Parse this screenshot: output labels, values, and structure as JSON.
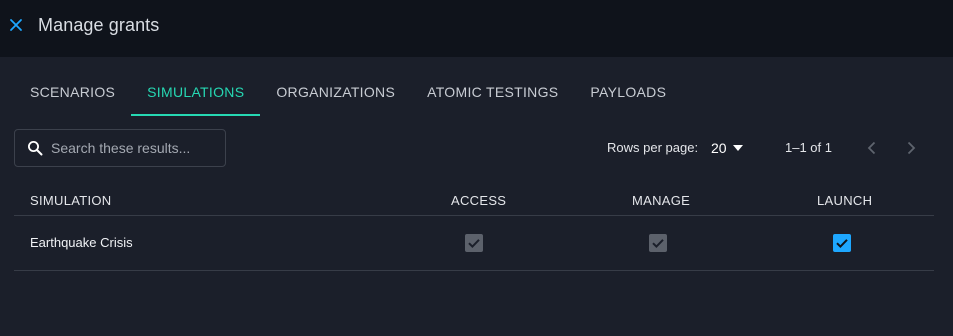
{
  "header": {
    "title": "Manage grants",
    "close_icon": "close-icon"
  },
  "tabs": [
    {
      "label": "SCENARIOS",
      "active": false
    },
    {
      "label": "SIMULATIONS",
      "active": true
    },
    {
      "label": "ORGANIZATIONS",
      "active": false
    },
    {
      "label": "ATOMIC TESTINGS",
      "active": false
    },
    {
      "label": "PAYLOADS",
      "active": false
    }
  ],
  "search": {
    "placeholder": "Search these results...",
    "value": ""
  },
  "pagination": {
    "rows_per_page_label": "Rows per page:",
    "rows_per_page_value": "20",
    "range_text": "1–1 of 1"
  },
  "table": {
    "columns": [
      "SIMULATION",
      "ACCESS",
      "MANAGE",
      "LAUNCH"
    ],
    "rows": [
      {
        "simulation": "Earthquake Crisis",
        "access": true,
        "manage": true,
        "launch": true,
        "access_disabled": true,
        "manage_disabled": true,
        "launch_disabled": false
      }
    ]
  },
  "colors": {
    "accent": "#26d8b3",
    "checkbox_active": "#1ea7ff",
    "checkbox_disabled": "#5c616b",
    "header_bg": "#0f131b",
    "page_bg": "#1b1f2a"
  }
}
